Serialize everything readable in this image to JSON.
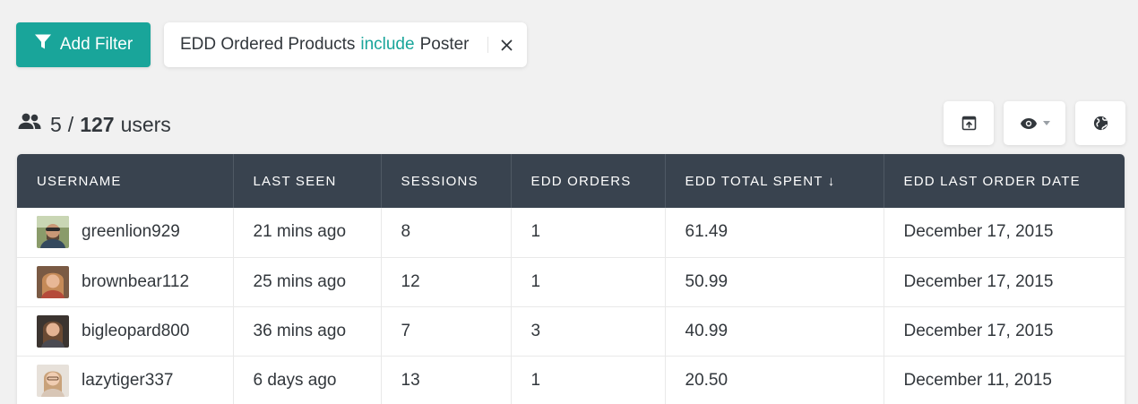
{
  "filter_bar": {
    "add_filter_label": "Add Filter",
    "chip": {
      "field": "EDD Ordered Products",
      "operator": "include",
      "value": "Poster"
    }
  },
  "summary": {
    "shown": "5",
    "separator": "/",
    "total": "127",
    "unit": "users"
  },
  "table": {
    "columns": [
      {
        "label": "USERNAME"
      },
      {
        "label": "LAST SEEN"
      },
      {
        "label": "SESSIONS"
      },
      {
        "label": "EDD ORDERS"
      },
      {
        "label": "EDD TOTAL SPENT ↓"
      },
      {
        "label": "EDD LAST ORDER DATE"
      }
    ],
    "rows": [
      {
        "username": "greenlion929",
        "last_seen": "21 mins ago",
        "sessions": "8",
        "orders": "1",
        "total_spent": "61.49",
        "last_order_date": "December 17, 2015"
      },
      {
        "username": "brownbear112",
        "last_seen": "25 mins ago",
        "sessions": "12",
        "orders": "1",
        "total_spent": "50.99",
        "last_order_date": "December 17, 2015"
      },
      {
        "username": "bigleopard800",
        "last_seen": "36 mins ago",
        "sessions": "7",
        "orders": "3",
        "total_spent": "40.99",
        "last_order_date": "December 17, 2015"
      },
      {
        "username": "lazytiger337",
        "last_seen": "6 days ago",
        "sessions": "13",
        "orders": "1",
        "total_spent": "20.50",
        "last_order_date": "December 11, 2015"
      }
    ]
  },
  "colors": {
    "accent": "#19a59a",
    "header_bg": "#39434f",
    "page_bg": "#f1f1f1"
  },
  "icons": {
    "filter": "funnel-icon",
    "remove": "close-icon",
    "users": "users-icon",
    "export": "export-icon",
    "view": "eye-icon",
    "dropdown": "caret-down-icon",
    "globe": "globe-icon"
  }
}
